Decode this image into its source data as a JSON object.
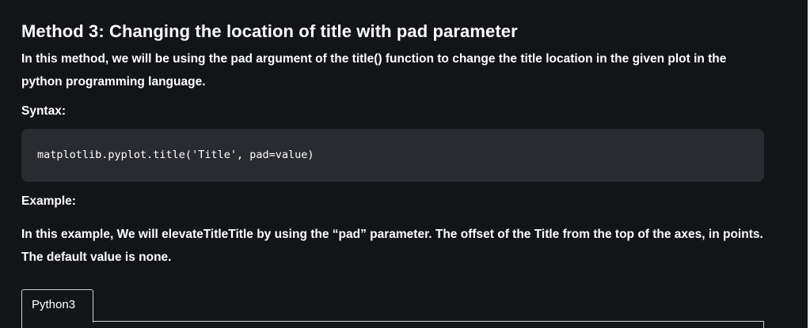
{
  "article": {
    "heading": "Method 3: Changing the location of title with pad parameter",
    "intro": "In this method, we will be using the pad argument of the title() function to change the title location in the given plot in the python programming language.",
    "syntax_label": "Syntax:",
    "syntax_code": "matplotlib.pyplot.title('Title', pad=value)",
    "example_label": "Example:",
    "example_text": "In this example, We will elevateTitleTitle by using the “pad” parameter. The offset of the Title from the top of the axes, in points. The default value is none."
  },
  "code_tabs": {
    "active_tab": "Python3"
  },
  "colors": {
    "background": "#131418",
    "code_background": "#2a2b31",
    "text": "#ffffff",
    "border": "#d0d0d0"
  }
}
